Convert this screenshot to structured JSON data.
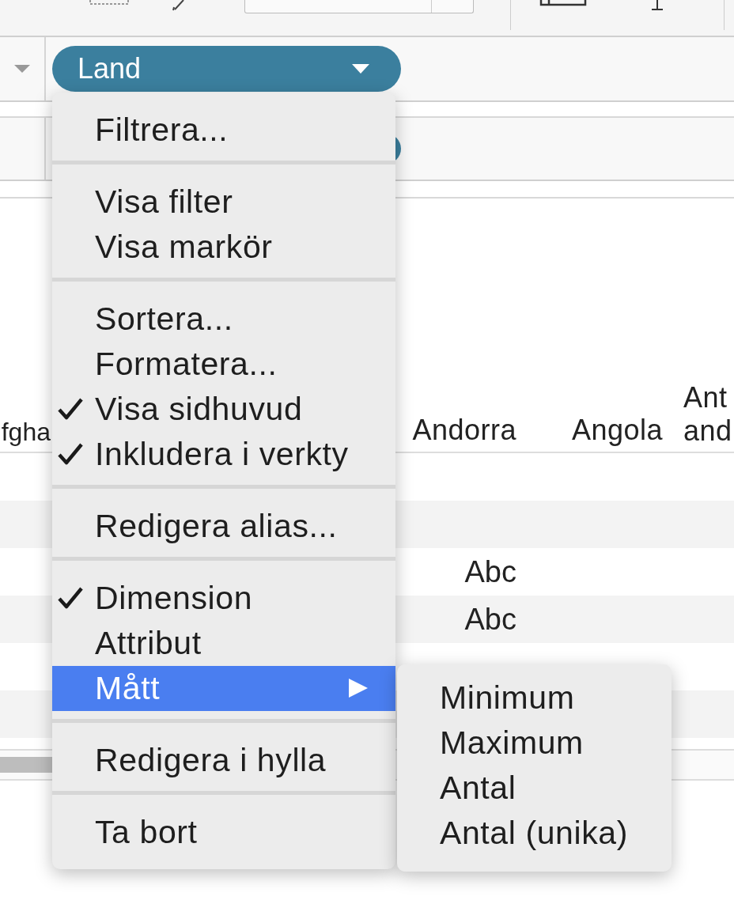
{
  "shelf": {
    "pill_label": "Land"
  },
  "table": {
    "header": [
      "fgha",
      "Andorra",
      "Angola",
      "Ant and"
    ],
    "rows": [
      {
        "cells": [
          null,
          null,
          null,
          null
        ]
      },
      {
        "cells": [
          null,
          null,
          null,
          null
        ]
      },
      {
        "cells": [
          null,
          "Abc",
          null,
          null
        ]
      },
      {
        "cells": [
          null,
          "Abc",
          null,
          null
        ]
      },
      {
        "cells": [
          null,
          null,
          null,
          null
        ]
      },
      {
        "cells": [
          null,
          null,
          null,
          null
        ]
      }
    ]
  },
  "context_menu": {
    "groups": [
      [
        {
          "label": "Filtrera...",
          "checked": false,
          "selected": false,
          "has_submenu": false
        }
      ],
      [
        {
          "label": "Visa filter",
          "checked": false,
          "selected": false,
          "has_submenu": false
        },
        {
          "label": "Visa markör",
          "checked": false,
          "selected": false,
          "has_submenu": false
        }
      ],
      [
        {
          "label": "Sortera...",
          "checked": false,
          "selected": false,
          "has_submenu": false
        },
        {
          "label": "Formatera...",
          "checked": false,
          "selected": false,
          "has_submenu": false
        },
        {
          "label": "Visa sidhuvud",
          "checked": true,
          "selected": false,
          "has_submenu": false
        },
        {
          "label": "Inkludera i verkty",
          "checked": true,
          "selected": false,
          "has_submenu": false
        }
      ],
      [
        {
          "label": "Redigera alias...",
          "checked": false,
          "selected": false,
          "has_submenu": false
        }
      ],
      [
        {
          "label": "Dimension",
          "checked": true,
          "selected": false,
          "has_submenu": false
        },
        {
          "label": "Attribut",
          "checked": false,
          "selected": false,
          "has_submenu": false
        },
        {
          "label": "Mått",
          "checked": false,
          "selected": true,
          "has_submenu": true
        }
      ],
      [
        {
          "label": "Redigera i hylla",
          "checked": false,
          "selected": false,
          "has_submenu": false
        }
      ],
      [
        {
          "label": "Ta bort",
          "checked": false,
          "selected": false,
          "has_submenu": false
        }
      ]
    ]
  },
  "submenu": {
    "items": [
      {
        "label": "Minimum",
        "selected": false
      },
      {
        "label": "Maximum",
        "selected": false
      },
      {
        "label": "Antal",
        "selected": false
      },
      {
        "label": "Antal (unika)",
        "selected": false
      }
    ]
  }
}
